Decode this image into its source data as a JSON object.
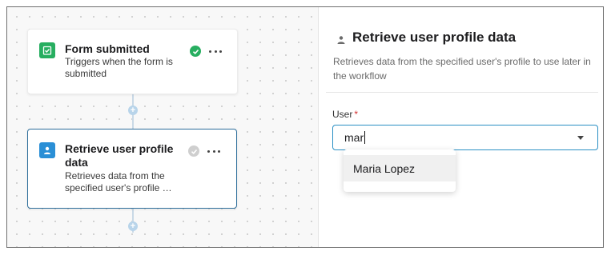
{
  "workflow": {
    "nodes": [
      {
        "title": "Form submitted",
        "description": "Triggers when the form is submitted",
        "icon": "clipboard-check-icon",
        "status": "complete",
        "color": "#27ae60"
      },
      {
        "title": "Retrieve user profile data",
        "description": "Retrieves data from the specified user's profile …",
        "icon": "user-icon",
        "status": "pending",
        "color": "#2a8fd6"
      }
    ]
  },
  "panel": {
    "icon": "user-icon",
    "title": "Retrieve user profile data",
    "description": "Retrieves data from the specified user's profile to use later in the workflow",
    "field": {
      "label": "User",
      "required_mark": "*",
      "value": "mar"
    },
    "dropdown": {
      "options": [
        "Maria Lopez"
      ]
    }
  },
  "colors": {
    "accent": "#2a8fc4",
    "success": "#27ae60",
    "required": "#d32f2f"
  }
}
